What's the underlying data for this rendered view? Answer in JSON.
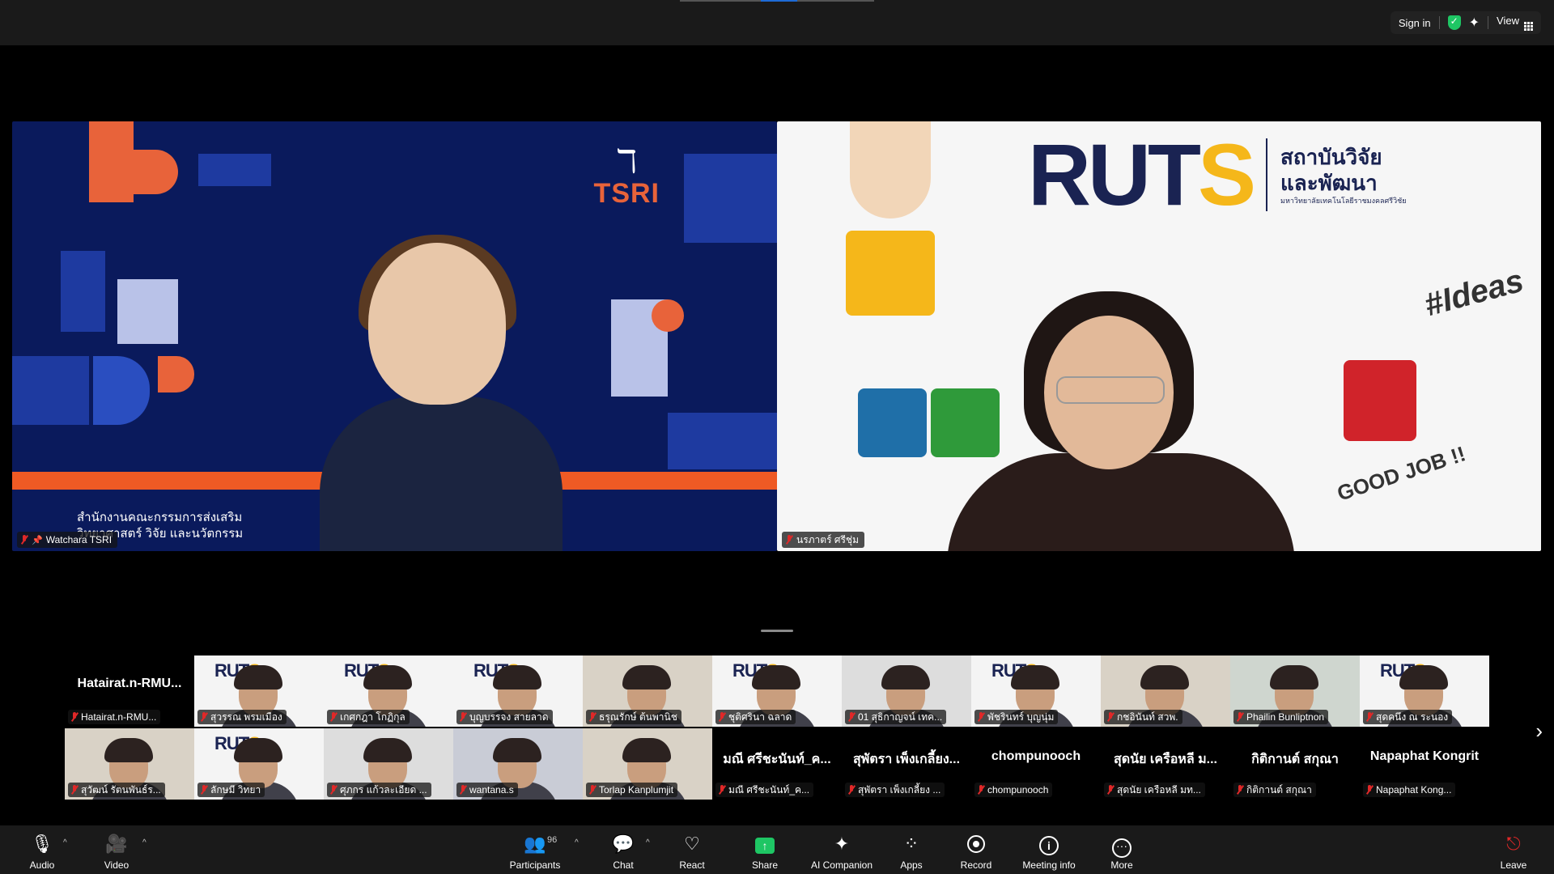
{
  "top_bar": {
    "sign_in": "Sign in",
    "view": "View"
  },
  "speakers": [
    {
      "name": "Watchara TSRI",
      "banner_line1": "สำนักงานคณะกรรมการส่งเสริม",
      "banner_line2": "วิทยาศาสตร์ วิจัย และนวัตกรรม",
      "logo": "TSRI"
    },
    {
      "name": "นรภาตร์ ศรีชุ่ม",
      "logo_word_a": "RUT",
      "logo_word_b": "S",
      "logo_thai_1": "สถาบันวิจัย",
      "logo_thai_2": "และพัฒนา",
      "logo_thai_sub": "มหาวิทยาลัยเทคโนโลยีราชมงคลศรีวิชัย",
      "ideas": "#Ideas",
      "good_job": "GOOD JOB !!"
    }
  ],
  "gallery": {
    "row1": [
      {
        "name": "Hatairat.n-RMU...",
        "tag": "Hatairat.n-RMU...",
        "video": false
      },
      {
        "name": "",
        "tag": "สุวรรณ พรมเมือง",
        "video": true,
        "slide": true
      },
      {
        "name": "",
        "tag": "เกศกฎา โกฏิกุล",
        "video": true,
        "slide": true
      },
      {
        "name": "",
        "tag": "บุญบรรจง สายลาด",
        "video": true,
        "slide": true
      },
      {
        "name": "",
        "tag": "ธรุณรักษ์ ต้นพานิช",
        "video": true
      },
      {
        "name": "",
        "tag": "ชุติศรินา ฉลาด",
        "video": true,
        "slide": true
      },
      {
        "name": "",
        "tag": "01 สุธิกาญจน์ เทค...",
        "video": true
      },
      {
        "name": "",
        "tag": "พัชรินทร์ บุญนุ่ม",
        "video": true,
        "slide": true
      },
      {
        "name": "",
        "tag": "กชอินันท์ สวพ.",
        "video": true
      },
      {
        "name": "",
        "tag": "Phailin Bunliptnon",
        "video": true
      },
      {
        "name": "",
        "tag": "สุดคนึง ณ ระนอง",
        "video": true,
        "slide": true
      }
    ],
    "row2": [
      {
        "name": "",
        "tag": "สุวัฒน์ รัตนพันธ์ร...",
        "video": true
      },
      {
        "name": "",
        "tag": "ลักษมี วิทยา",
        "video": true,
        "slide": true
      },
      {
        "name": "",
        "tag": "ศุภกร แก้วละเอียด ...",
        "video": true
      },
      {
        "name": "",
        "tag": "wantana.s",
        "video": true
      },
      {
        "name": "",
        "tag": "Torlap Kanplumjit",
        "video": true
      },
      {
        "name": "มณี ศรีชะนันท์_ค...",
        "tag": "มณี ศรีชะนันท์_ค...",
        "video": false
      },
      {
        "name": "สุพัตรา เพ็งเกลี้ยง...",
        "tag": "สุพัตรา เพ็งเกลี้ยง ...",
        "video": false
      },
      {
        "name": "chompunooch",
        "tag": "chompunooch",
        "video": false
      },
      {
        "name": "สุดนัย เครือหลี ม...",
        "tag": "สุดนัย เครือหลี มท...",
        "video": false
      },
      {
        "name": "กิติกานต์ สกุณา",
        "tag": "กิติกานต์ สกุณา",
        "video": false
      },
      {
        "name": "Napaphat Kongrit",
        "tag": "Napaphat Kong...",
        "video": false
      }
    ]
  },
  "toolbar": {
    "audio": "Audio",
    "video": "Video",
    "participants": "Participants",
    "participants_count": "96",
    "chat": "Chat",
    "react": "React",
    "share": "Share",
    "ai_companion": "AI Companion",
    "apps": "Apps",
    "record": "Record",
    "meeting_info": "Meeting info",
    "more": "More",
    "leave": "Leave"
  },
  "colors": {
    "accent_green": "#1ec664",
    "muted_red": "#e02828",
    "tsri_orange": "#ef5a24",
    "ruts_navy": "#1a2352",
    "ruts_yellow": "#f5b71a"
  }
}
